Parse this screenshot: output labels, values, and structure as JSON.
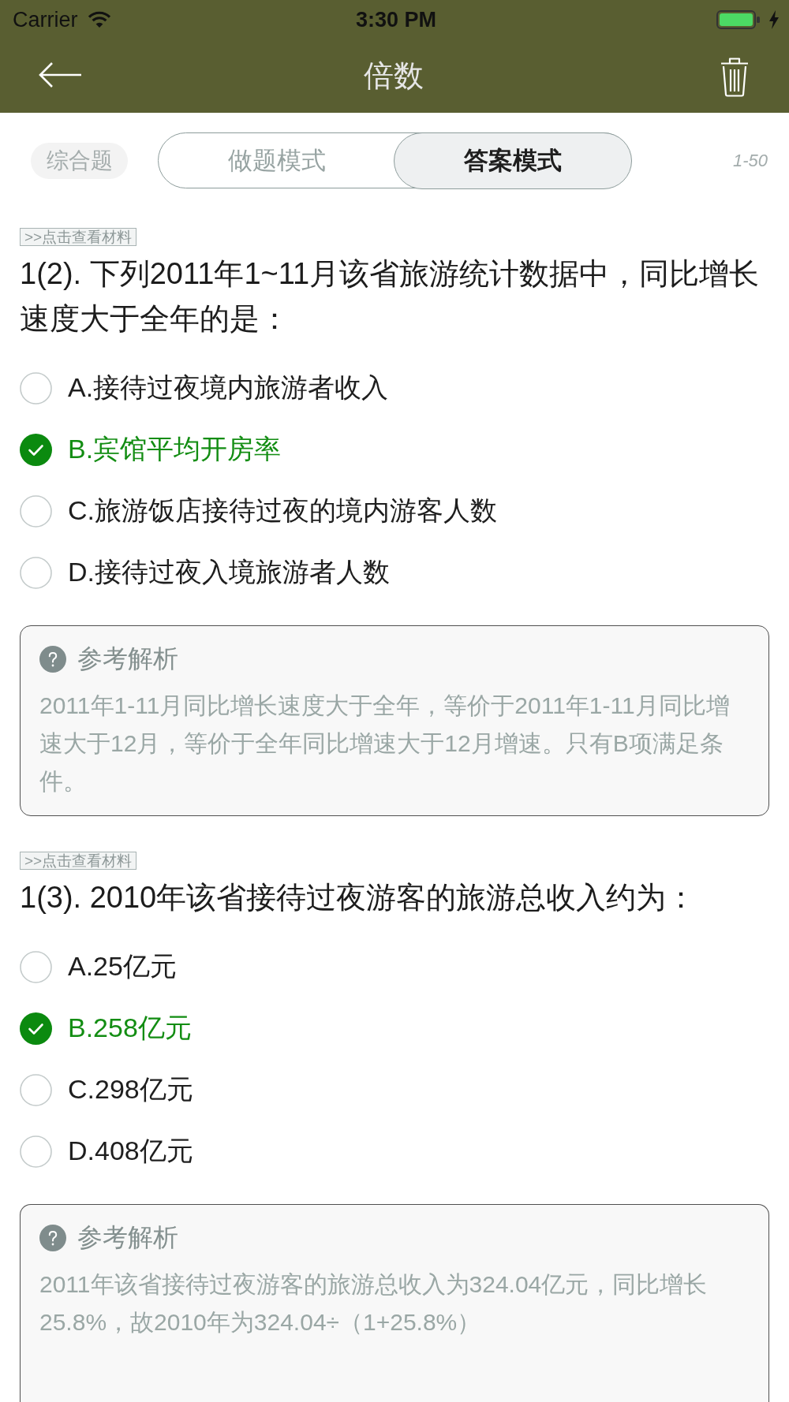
{
  "status_bar": {
    "carrier": "Carrier",
    "time": "3:30 PM"
  },
  "nav_bar": {
    "title": "倍数"
  },
  "toolbar": {
    "category": "综合题",
    "mode_tabs": [
      {
        "label": "做题模式",
        "selected": false
      },
      {
        "label": "答案模式",
        "selected": true
      }
    ],
    "range": "1-50"
  },
  "questions": [
    {
      "material_link": ">>点击查看材料",
      "text": "1(2). 下列2011年1~11月该省旅游统计数据中，同比增长速度大于全年的是：",
      "options": [
        {
          "label": "A.接待过夜境内旅游者收入",
          "selected": false
        },
        {
          "label": "B.宾馆平均开房率",
          "selected": true
        },
        {
          "label": "C.旅游饭店接待过夜的境内游客人数",
          "selected": false
        },
        {
          "label": "D.接待过夜入境旅游者人数",
          "selected": false
        }
      ],
      "explanation": {
        "heading": "参考解析",
        "text": "2011年1-11月同比增长速度大于全年，等价于2011年1-11月同比增速大于12月，等价于全年同比增速大于12月增速。只有B项满足条件。"
      }
    },
    {
      "material_link": ">>点击查看材料",
      "text": "1(3). 2010年该省接待过夜游客的旅游总收入约为：",
      "options": [
        {
          "label": "A.25亿元",
          "selected": false
        },
        {
          "label": "B.258亿元",
          "selected": true
        },
        {
          "label": "C.298亿元",
          "selected": false
        },
        {
          "label": "D.408亿元",
          "selected": false
        }
      ],
      "explanation": {
        "heading": "参考解析",
        "text": "2011年该省接待过夜游客的旅游总收入为324.04亿元，同比增长25.8%，故2010年为324.04÷（1+25.8%）"
      }
    }
  ]
}
